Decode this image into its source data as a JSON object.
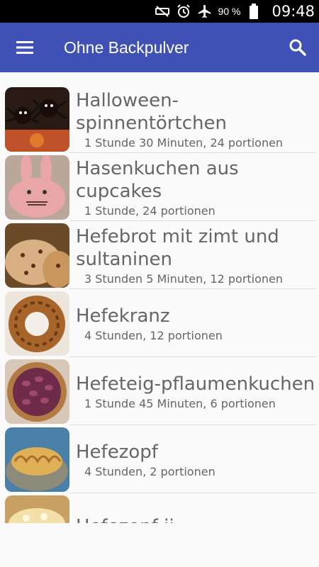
{
  "statusbar": {
    "icons": [
      "mute-icon",
      "alarm-icon",
      "airplane-icon"
    ],
    "battery_percent": "90 %",
    "time": "09:48"
  },
  "appbar": {
    "title": "Ohne Backpulver",
    "menu_icon": "hamburger-menu-icon",
    "search_icon": "search-icon"
  },
  "recipes": [
    {
      "name": "Halloween-spinnentörtchen",
      "meta": "1 Stunde 30 Minuten, 24 portionen"
    },
    {
      "name": "Hasenkuchen aus cupcakes",
      "meta": "1 Stunde, 24 portionen"
    },
    {
      "name": "Hefebrot mit zimt und sultaninen",
      "meta": "3 Stunden 5 Minuten, 12 portionen"
    },
    {
      "name": "Hefekranz",
      "meta": "4 Stunden, 12 portionen"
    },
    {
      "name": "Hefeteig-pflaumenkuchen",
      "meta": "1 Stunde 45 Minuten, 6 portionen"
    },
    {
      "name": "Hefezopf",
      "meta": "4 Stunden, 2 portionen"
    },
    {
      "name": "Hefezopf ii",
      "meta": ""
    }
  ]
}
